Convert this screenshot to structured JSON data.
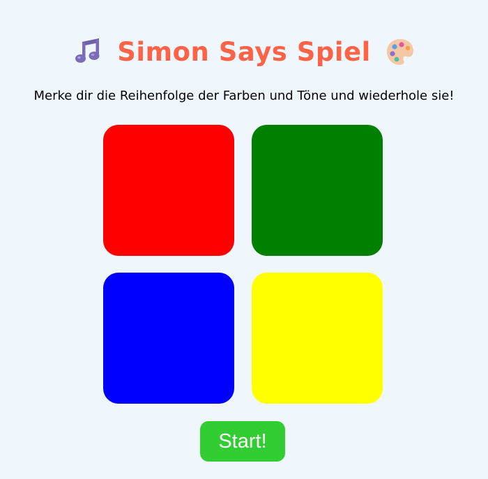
{
  "header": {
    "title": "Simon Says Spiel",
    "left_icon": "music-notes-icon",
    "right_icon": "artist-palette-icon"
  },
  "instructions": "Merke dir die Reihenfolge der Farben und Töne und wiederhole sie!",
  "pads": [
    {
      "name": "red",
      "color": "#ff0000"
    },
    {
      "name": "green",
      "color": "#008000"
    },
    {
      "name": "blue",
      "color": "#0000ff"
    },
    {
      "name": "yellow",
      "color": "#ffff00"
    }
  ],
  "controls": {
    "start_label": "Start!",
    "start_color": "#32cd32"
  },
  "colors": {
    "background": "#eff7fd",
    "title": "#ff6347"
  }
}
